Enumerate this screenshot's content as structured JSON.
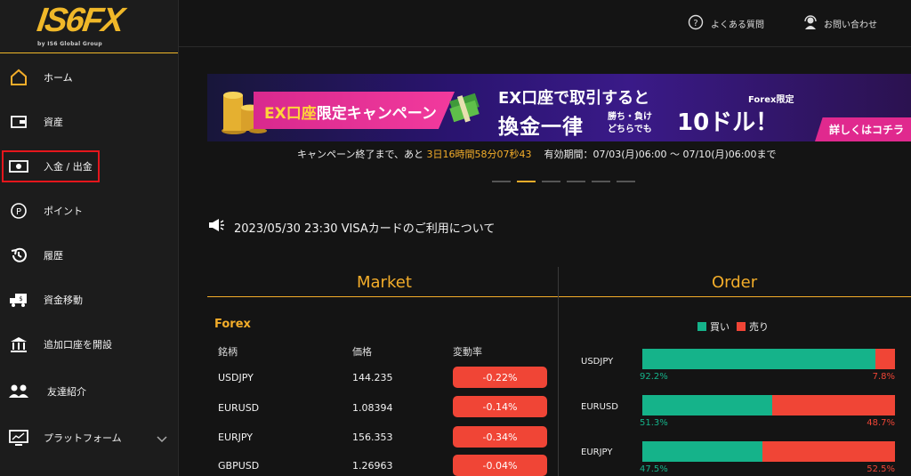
{
  "brand": {
    "logo_text": "IS6FX",
    "logo_sub": "by IS6 Global Group",
    "accent": "#f3ad2a",
    "buy_color": "#15b38a",
    "sell_color": "#f04536"
  },
  "sidebar": {
    "items": [
      {
        "label": "ホーム",
        "icon": "home-icon"
      },
      {
        "label": "資産",
        "icon": "wallet-icon"
      },
      {
        "label": "入金 / 出金",
        "icon": "cash-icon"
      },
      {
        "label": "ポイント",
        "icon": "points-icon"
      },
      {
        "label": "履歴",
        "icon": "history-icon"
      },
      {
        "label": "資金移動",
        "icon": "truck-icon"
      },
      {
        "label": "追加口座を開設",
        "icon": "bank-icon"
      },
      {
        "label": "友達紹介",
        "icon": "users-icon"
      },
      {
        "label": "プラットフォーム",
        "icon": "monitor-icon"
      }
    ]
  },
  "header": {
    "faq": "よくある質問",
    "contact": "お問い合わせ"
  },
  "banner": {
    "campaign_pre": "EX口座",
    "campaign_post": "限定キャンペーン",
    "line1": "EX口座で取引すると",
    "line2": "換金一律",
    "small1": "勝ち・負け",
    "small2": "どちらでも",
    "big": "10ドル！",
    "forex_only": "Forex限定",
    "button": "詳しくはコチラ",
    "countdown_pre": "キャンペーン終了まで、あと ",
    "countdown": "3日16時間58分07秒43",
    "period": "有効期間：07/03(月)06:00 〜 07/10(月)06:00まで"
  },
  "notice": {
    "text": "2023/05/30 23:30  VISAカードのご利用について"
  },
  "market": {
    "title": "Market",
    "section": "Forex",
    "headers": [
      "銘柄",
      "価格",
      "変動率"
    ],
    "rows": [
      {
        "symbol": "USDJPY",
        "price": "144.235",
        "change": "-0.22%"
      },
      {
        "symbol": "EURUSD",
        "price": "1.08394",
        "change": "-0.14%"
      },
      {
        "symbol": "EURJPY",
        "price": "156.353",
        "change": "-0.34%"
      },
      {
        "symbol": "GBPUSD",
        "price": "1.26963",
        "change": "-0.04%"
      }
    ]
  },
  "order": {
    "title": "Order",
    "legend_buy": "買い",
    "legend_sell": "売り",
    "rows": [
      {
        "symbol": "USDJPY",
        "buy": 92.2,
        "buy_label": "92.2%",
        "sell_label": "7.8%"
      },
      {
        "symbol": "EURUSD",
        "buy": 51.3,
        "buy_label": "51.3%",
        "sell_label": "48.7%"
      },
      {
        "symbol": "EURJPY",
        "buy": 47.5,
        "buy_label": "47.5%",
        "sell_label": "52.5%"
      }
    ]
  }
}
